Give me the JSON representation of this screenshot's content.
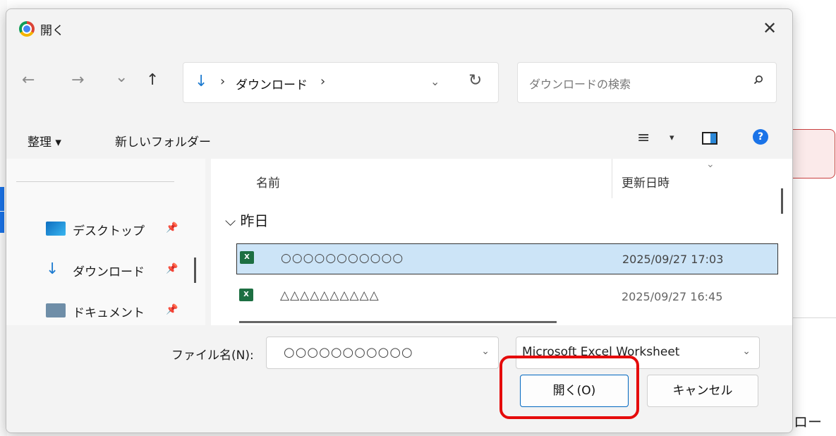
{
  "dialog": {
    "title": "開く",
    "close": "✕"
  },
  "nav": {
    "back": "←",
    "forward": "→",
    "recent": "⌄",
    "up": "↑"
  },
  "address": {
    "icon": "↓",
    "separator": "›",
    "path": "ダウンロード",
    "chevron": "⌄",
    "refresh": "↻"
  },
  "search": {
    "placeholder": "ダウンロードの検索"
  },
  "toolbar": {
    "organize": "整理 ▾",
    "new_folder": "新しいフォルダー",
    "view_icon": "≡",
    "view_caret": "▾",
    "help": "?"
  },
  "sidebar": {
    "items": [
      {
        "label": "デスクトップ",
        "pin": "📌"
      },
      {
        "label": "ダウンロード",
        "pin": "📌"
      },
      {
        "label": "ドキュメント",
        "pin": "📌"
      }
    ]
  },
  "filelist": {
    "col_name": "名前",
    "col_date": "更新日時",
    "col_chevron": "⌄",
    "group": "⌵ 昨日",
    "files": [
      {
        "icon": "X",
        "name": "○○○○○○○○○○○",
        "date": "2025/09/27 17:03"
      },
      {
        "icon": "X",
        "name": "△△△△△△△△△△",
        "date": "2025/09/27 16:45"
      }
    ]
  },
  "bottom": {
    "file_name_label": "ファイル名(N):",
    "file_name_value": "○○○○○○○○○○○",
    "file_name_chevron": "⌄",
    "file_type": "Microsoft Excel Worksheet",
    "file_type_chevron": "⌄",
    "open_button": "開く(O)",
    "cancel_button": "キャンセル"
  },
  "background": {
    "fragment_text": "ロー"
  },
  "colors": {
    "accent": "#1a73e8",
    "selection": "#cce4f7",
    "highlight": "#e50b0b",
    "excel": "#1d6f42"
  }
}
